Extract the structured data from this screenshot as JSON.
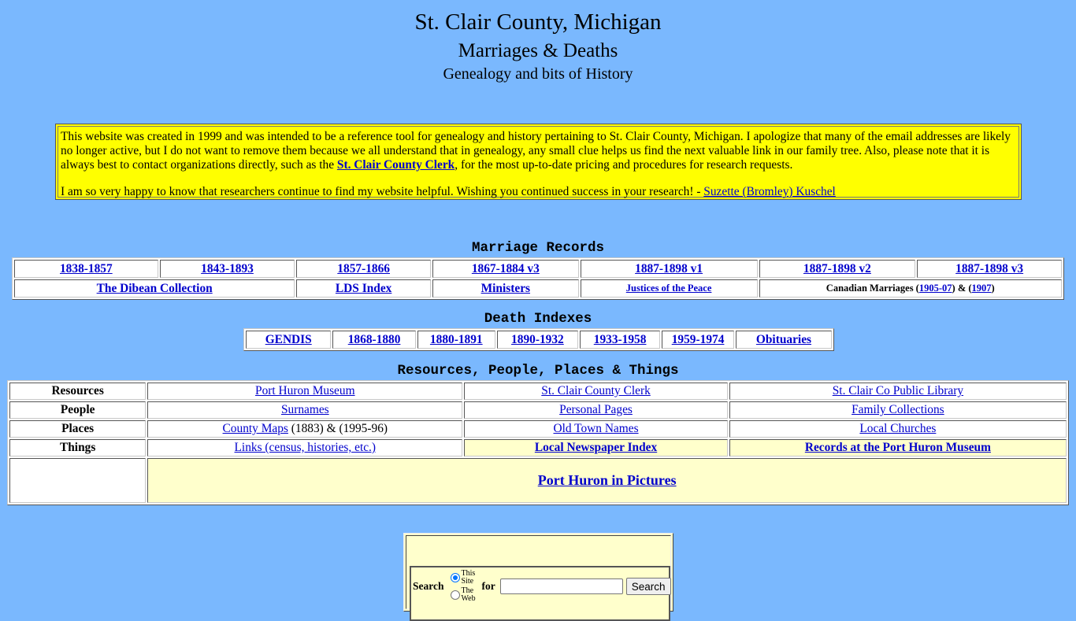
{
  "header": {
    "title": "St. Clair County, Michigan",
    "subtitle": "Marriages & Deaths",
    "tagline": "Genealogy and bits of History"
  },
  "notice": {
    "p1_before": "This website was created in 1999 and was intended to be a reference tool for genealogy and history pertaining to St. Clair County, Michigan. I apologize that many of the email addresses are likely no longer active, but I do not want to remove them because we all understand that in genealogy, any small clue helps us find the next valuable link in our family tree. Also, please note that it is always best to contact organizations directly, such as the ",
    "p1_link": "St. Clair County Clerk",
    "p1_after": ", for the most up-to-date pricing and procedures for research requests.",
    "p2_before": "I am so very happy to know that researchers continue to find my website helpful. Wishing you continued success in your research! - ",
    "p2_link": "Suzette (Bromley) Kuschel"
  },
  "marriage": {
    "title": "Marriage Records",
    "row1": [
      "1838-1857",
      "1843-1893",
      "1857-1866",
      "1867-1884 v3",
      "1887-1898 v1",
      "1887-1898 v2",
      "1887-1898 v3"
    ],
    "row2": {
      "dibean": "The Dibean Collection",
      "lds": "LDS Index",
      "ministers": "Ministers",
      "justices": "Justices of the Peace",
      "canadian_label": "Canadian Marriages (",
      "canadian_link1": "1905-07",
      "canadian_mid": ") & (",
      "canadian_link2": "1907",
      "canadian_end": ")"
    }
  },
  "death": {
    "title": "Death Indexes",
    "links": [
      "GENDIS",
      "1868-1880",
      "1880-1891",
      "1890-1932",
      "1933-1958",
      "1959-1974",
      "Obituaries"
    ]
  },
  "resources": {
    "title": "Resources, People, Places & Things",
    "rows": [
      {
        "label": "Resources",
        "c1": "Port Huron Museum",
        "c2": "St. Clair County Clerk",
        "c3": "St. Clair Co Public Library"
      },
      {
        "label": "People",
        "c1": "Surnames",
        "c2": "Personal Pages",
        "c3": "Family Collections"
      },
      {
        "label": "Places",
        "c1": "County Maps",
        "c1_extra": " (1883) & (1995-96)",
        "c2": "Old Town Names",
        "c3": "Local Churches"
      },
      {
        "label": "Things",
        "c1": "Links (census, histories, etc.)",
        "c2": "Local Newspaper Index",
        "c3": "Records at the Port Huron Museum"
      }
    ],
    "feature": "Port Huron in Pictures"
  },
  "search": {
    "label": "Search",
    "option1": "This Site",
    "option2": "The Web",
    "selected": "This Site",
    "for_label": "for",
    "query": "",
    "button": "Search"
  }
}
